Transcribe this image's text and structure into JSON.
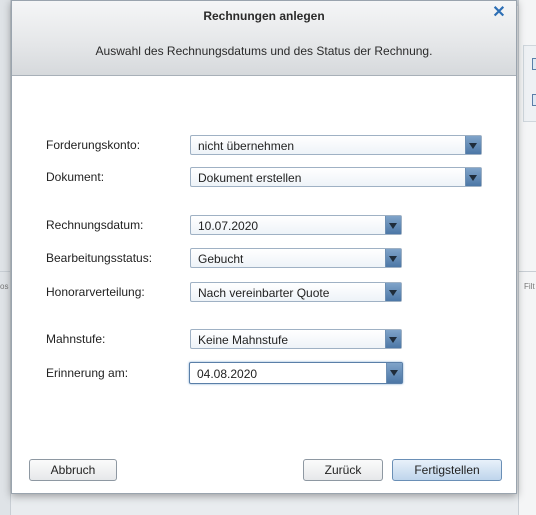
{
  "dialog": {
    "title": "Rechnungen anlegen",
    "subtitle": "Auswahl des Rechnungsdatums und des Status der Rechnung.",
    "close_icon": "close-icon"
  },
  "form": {
    "forderungskonto": {
      "label": "Forderungskonto:",
      "value": "nicht übernehmen"
    },
    "dokument": {
      "label": "Dokument:",
      "value": "Dokument erstellen"
    },
    "rechnungsdatum": {
      "label": "Rechnungsdatum:",
      "value": "10.07.2020"
    },
    "bearbeitungsstatus": {
      "label": "Bearbeitungsstatus:",
      "value": "Gebucht"
    },
    "honorarverteilung": {
      "label": "Honorarverteilung:",
      "value": "Nach vereinbarter Quote"
    },
    "mahnstufe": {
      "label": "Mahnstufe:",
      "value": "Keine Mahnstufe"
    },
    "erinnerung": {
      "label": "Erinnerung am:",
      "value": "04.08.2020"
    }
  },
  "buttons": {
    "abbruch": "Abbruch",
    "zurueck": "Zurück",
    "fertigstellen": "Fertigstellen"
  },
  "background": {
    "left_fragment": "os",
    "right_fragment": "Filt"
  },
  "colors": {
    "accent": "#4c77a6",
    "close": "#2d6fb5",
    "header_bg": "#e4e6e8"
  }
}
